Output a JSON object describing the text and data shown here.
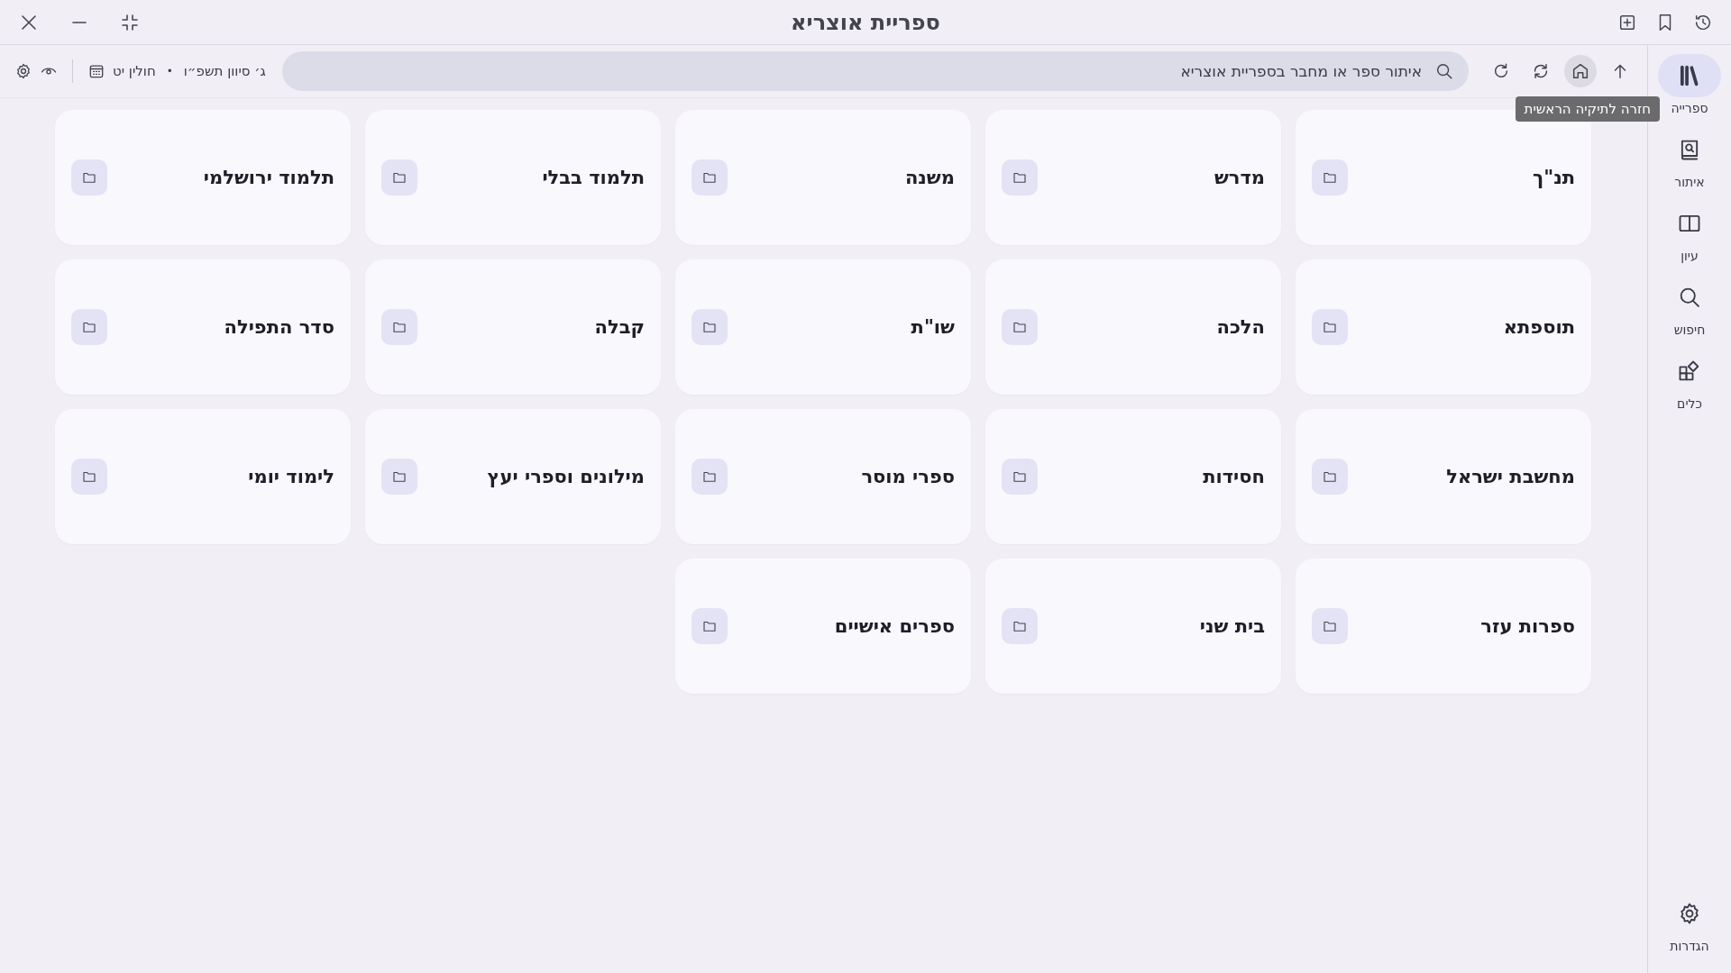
{
  "window": {
    "title": "ספריית אוצריא"
  },
  "toolbar": {
    "nav_buttons": [
      {
        "kind": "up",
        "highlighted": false
      },
      {
        "kind": "home",
        "highlighted": true
      },
      {
        "kind": "sync",
        "highlighted": false
      },
      {
        "kind": "refresh",
        "highlighted": false
      }
    ],
    "search": {
      "placeholder": "איתור ספר או מחבר בספריית אוצריא"
    },
    "date": "ג׳ סיוון תשפ״ו",
    "separator": "•",
    "daf": "חולין יט",
    "tooltip": "חזרה לתיקיה הראשית"
  },
  "sidebar": {
    "items": [
      {
        "kind": "library",
        "label": "ספרייה",
        "selected": true
      },
      {
        "kind": "find",
        "label": "איתור",
        "selected": false
      },
      {
        "kind": "study",
        "label": "עיון",
        "selected": false
      },
      {
        "kind": "search",
        "label": "חיפוש",
        "selected": false
      },
      {
        "kind": "tools",
        "label": "כלים",
        "selected": false
      }
    ],
    "settings": {
      "label": "הגדרות"
    }
  },
  "categories": [
    {
      "name": "תנ\"ך"
    },
    {
      "name": "מדרש"
    },
    {
      "name": "משנה"
    },
    {
      "name": "תלמוד בבלי"
    },
    {
      "name": "תלמוד ירושלמי"
    },
    {
      "name": "תוספתא"
    },
    {
      "name": "הלכה"
    },
    {
      "name": "שו\"ת"
    },
    {
      "name": "קבלה"
    },
    {
      "name": "סדר התפילה"
    },
    {
      "name": "מחשבת ישראל"
    },
    {
      "name": "חסידות"
    },
    {
      "name": "ספרי מוסר"
    },
    {
      "name": "מילונים וספרי יעץ"
    },
    {
      "name": "לימוד יומי"
    },
    {
      "name": "ספרות עזר"
    },
    {
      "name": "בית שני"
    },
    {
      "name": "ספרים אישיים"
    }
  ]
}
